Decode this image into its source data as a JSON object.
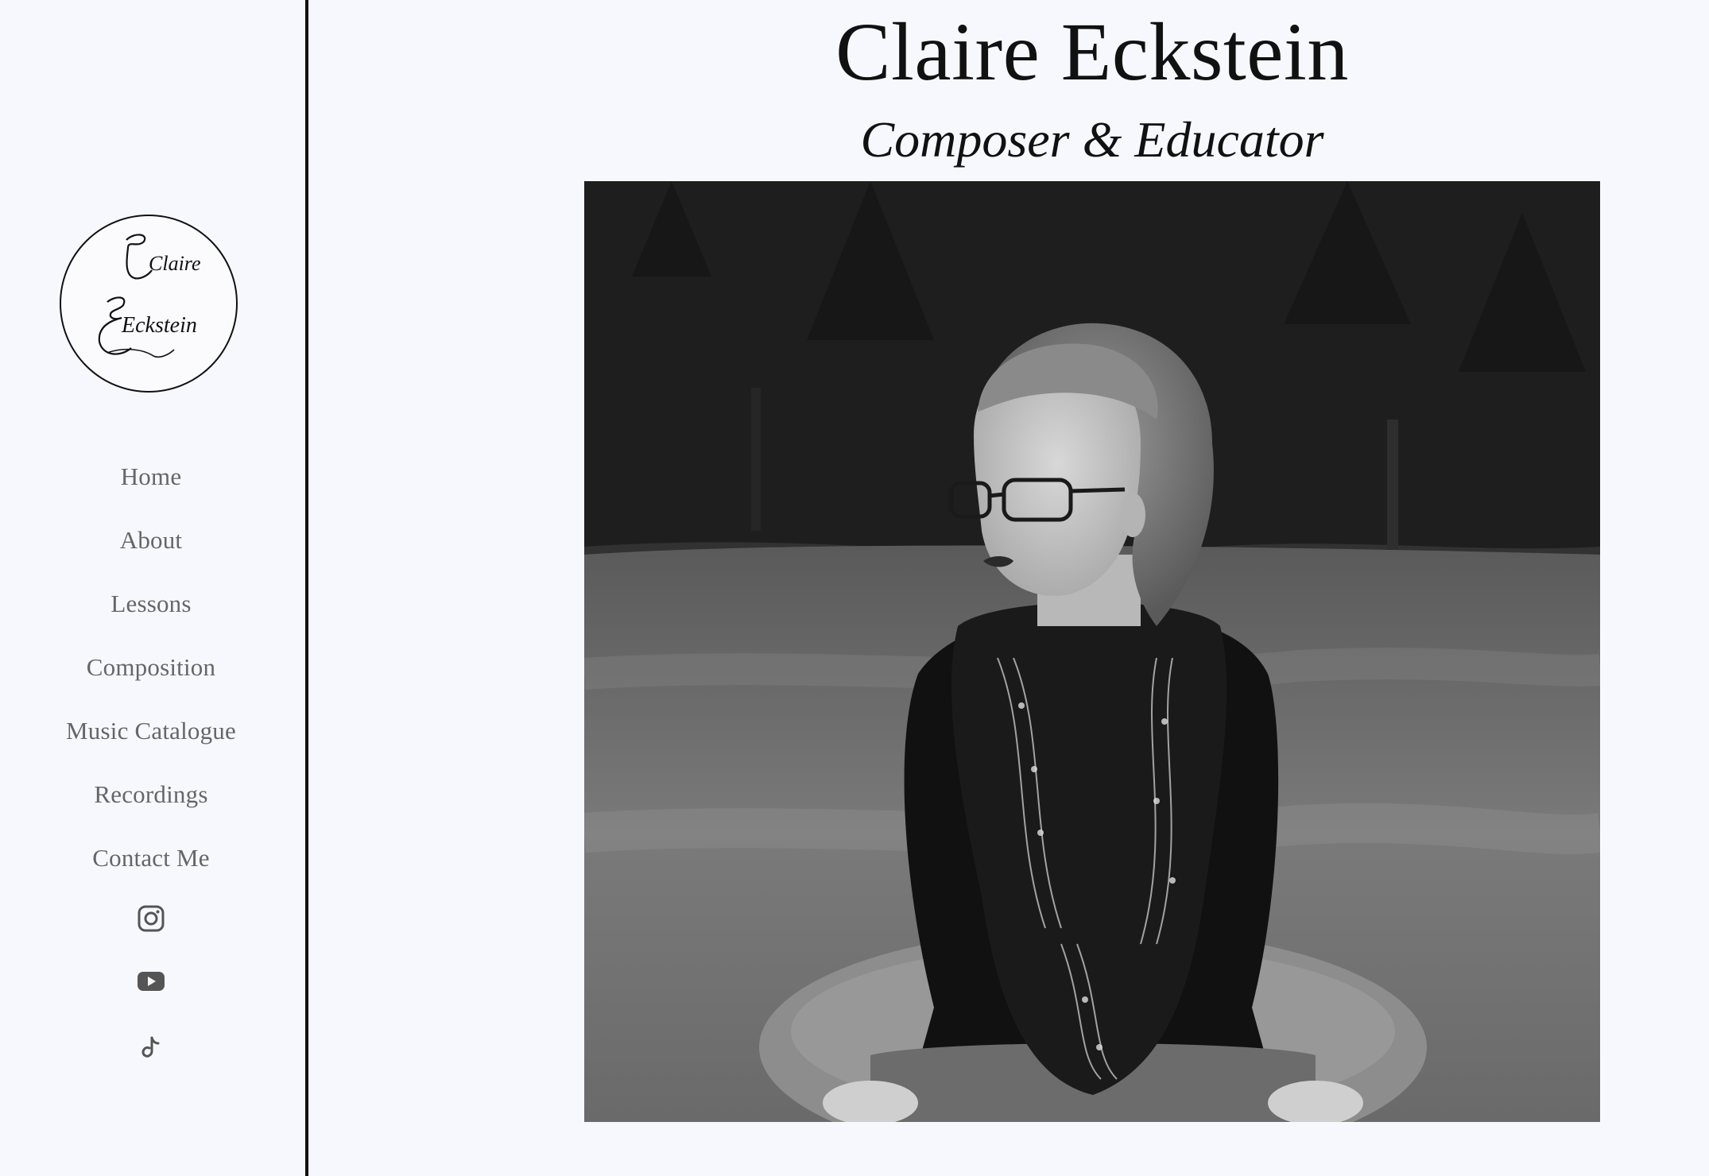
{
  "site": {
    "name": "Claire Eckstein",
    "tagline": "Composer & Educator"
  },
  "logo": {
    "line1": "Claire",
    "line2": "Eckstein"
  },
  "nav": {
    "items": [
      {
        "label": "Home"
      },
      {
        "label": "About"
      },
      {
        "label": "Lessons"
      },
      {
        "label": "Composition"
      },
      {
        "label": "Music Catalogue"
      },
      {
        "label": "Recordings"
      },
      {
        "label": "Contact Me"
      }
    ]
  },
  "social": {
    "icons": [
      "instagram-icon",
      "youtube-icon",
      "tiktok-icon"
    ]
  },
  "colors": {
    "background": "#f7f8fd",
    "text": "#111111",
    "nav_text": "#666666"
  }
}
